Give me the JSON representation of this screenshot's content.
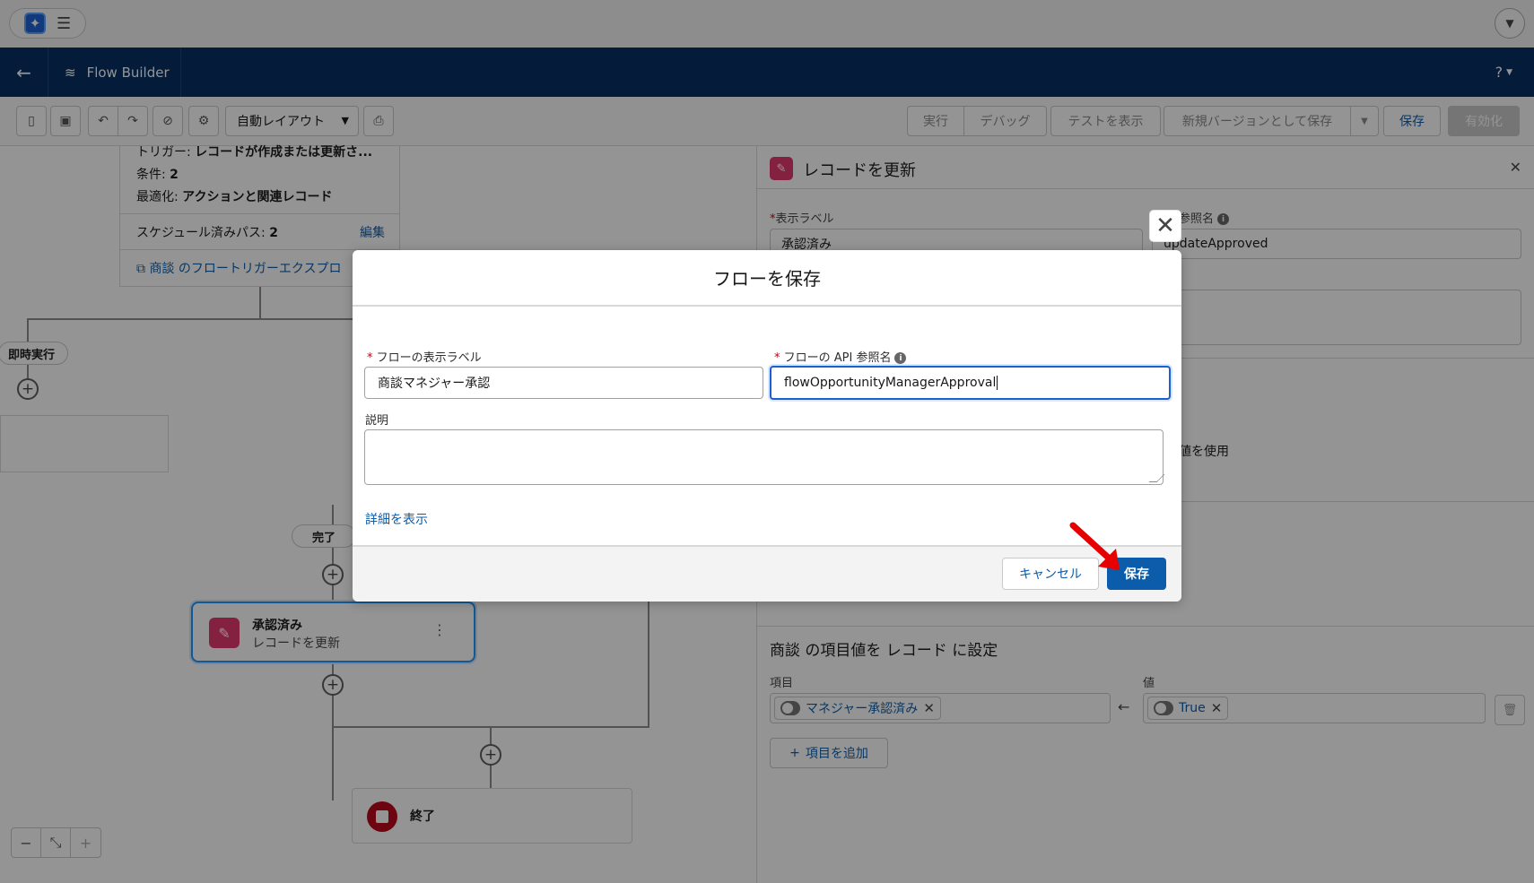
{
  "toolbar": {
    "layout_select": "自動レイアウト",
    "run": "実行",
    "debug": "デバッグ",
    "view_tests": "テストを表示",
    "save_as_new_version": "新規バージョンとして保存",
    "save": "保存",
    "activate": "有効化"
  },
  "header": {
    "app_title": "Flow Builder",
    "help": "?"
  },
  "canvas": {
    "start_card": {
      "trigger_label": "トリガー:",
      "trigger_value": "レコードが作成または更新さ...",
      "conditions_label": "条件:",
      "conditions_value": "2",
      "optimization_label": "最適化:",
      "optimization_value": "アクションと関連レコード",
      "scheduled_paths_label": "スケジュール済みパス:",
      "scheduled_paths_value": "2",
      "edit": "編集",
      "explorer_link": "商談 のフロートリガーエクスプロ"
    },
    "immediate_label": "即時実行",
    "complete_label": "完了",
    "node": {
      "title": "承認済み",
      "subtitle": "レコードを更新"
    },
    "end_node": "終了"
  },
  "panel": {
    "title": "レコードを更新",
    "display_label_label": "表示ラベル",
    "display_label_value": "承認済み",
    "api_name_label": "参照名",
    "api_name_value": "updateApproved",
    "use_value_text": "値を使用",
    "section_title": "商談 の項目値を レコード に設定",
    "field_label": "項目",
    "value_label": "値",
    "field_chip": "マネジャー承認済み",
    "value_chip": "True",
    "add_field": "項目を追加"
  },
  "modal": {
    "title": "フローを保存",
    "label_field_label": "フローの表示ラベル",
    "label_field_value": "商談マネジャー承認",
    "api_field_label": "フローの API 参照名",
    "api_field_value": "flowOpportunityManagerApproval",
    "description_label": "説明",
    "show_details": "詳細を表示",
    "cancel": "キャンセル",
    "save": "保存"
  },
  "colors": {
    "brand_navy": "#032d60",
    "primary_blue": "#0b5cab",
    "annotation_red": "#e60000"
  }
}
